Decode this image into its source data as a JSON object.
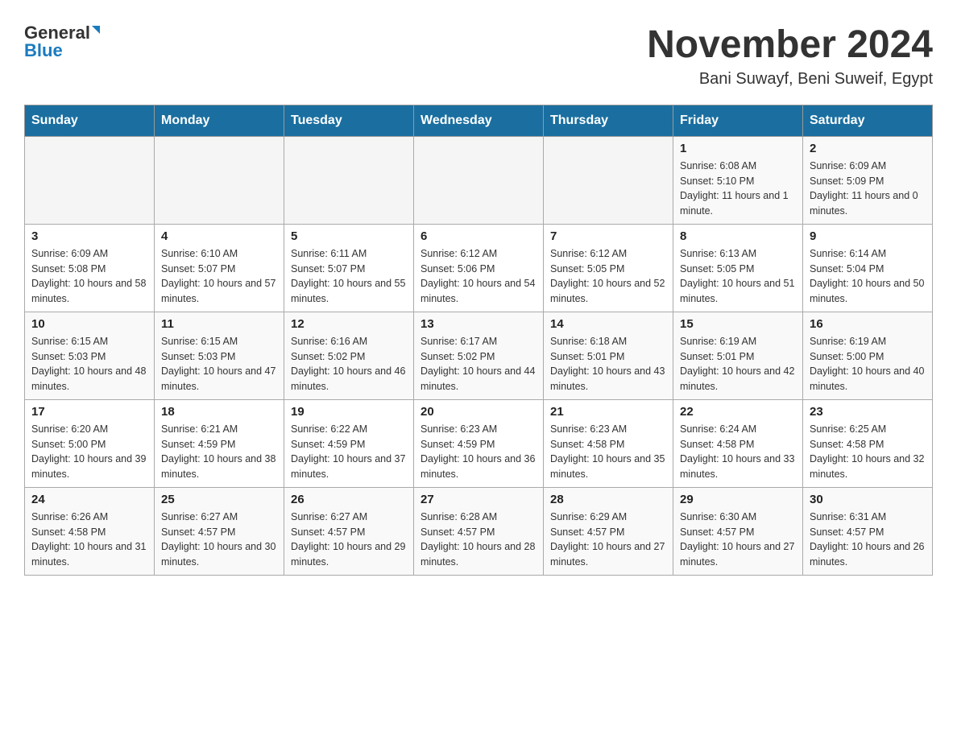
{
  "header": {
    "logo_general": "General",
    "logo_blue": "Blue",
    "title": "November 2024",
    "subtitle": "Bani Suwayf, Beni Suweif, Egypt"
  },
  "days_of_week": [
    "Sunday",
    "Monday",
    "Tuesday",
    "Wednesday",
    "Thursday",
    "Friday",
    "Saturday"
  ],
  "weeks": [
    {
      "days": [
        {
          "number": "",
          "info": ""
        },
        {
          "number": "",
          "info": ""
        },
        {
          "number": "",
          "info": ""
        },
        {
          "number": "",
          "info": ""
        },
        {
          "number": "",
          "info": ""
        },
        {
          "number": "1",
          "info": "Sunrise: 6:08 AM\nSunset: 5:10 PM\nDaylight: 11 hours and 1 minute."
        },
        {
          "number": "2",
          "info": "Sunrise: 6:09 AM\nSunset: 5:09 PM\nDaylight: 11 hours and 0 minutes."
        }
      ]
    },
    {
      "days": [
        {
          "number": "3",
          "info": "Sunrise: 6:09 AM\nSunset: 5:08 PM\nDaylight: 10 hours and 58 minutes."
        },
        {
          "number": "4",
          "info": "Sunrise: 6:10 AM\nSunset: 5:07 PM\nDaylight: 10 hours and 57 minutes."
        },
        {
          "number": "5",
          "info": "Sunrise: 6:11 AM\nSunset: 5:07 PM\nDaylight: 10 hours and 55 minutes."
        },
        {
          "number": "6",
          "info": "Sunrise: 6:12 AM\nSunset: 5:06 PM\nDaylight: 10 hours and 54 minutes."
        },
        {
          "number": "7",
          "info": "Sunrise: 6:12 AM\nSunset: 5:05 PM\nDaylight: 10 hours and 52 minutes."
        },
        {
          "number": "8",
          "info": "Sunrise: 6:13 AM\nSunset: 5:05 PM\nDaylight: 10 hours and 51 minutes."
        },
        {
          "number": "9",
          "info": "Sunrise: 6:14 AM\nSunset: 5:04 PM\nDaylight: 10 hours and 50 minutes."
        }
      ]
    },
    {
      "days": [
        {
          "number": "10",
          "info": "Sunrise: 6:15 AM\nSunset: 5:03 PM\nDaylight: 10 hours and 48 minutes."
        },
        {
          "number": "11",
          "info": "Sunrise: 6:15 AM\nSunset: 5:03 PM\nDaylight: 10 hours and 47 minutes."
        },
        {
          "number": "12",
          "info": "Sunrise: 6:16 AM\nSunset: 5:02 PM\nDaylight: 10 hours and 46 minutes."
        },
        {
          "number": "13",
          "info": "Sunrise: 6:17 AM\nSunset: 5:02 PM\nDaylight: 10 hours and 44 minutes."
        },
        {
          "number": "14",
          "info": "Sunrise: 6:18 AM\nSunset: 5:01 PM\nDaylight: 10 hours and 43 minutes."
        },
        {
          "number": "15",
          "info": "Sunrise: 6:19 AM\nSunset: 5:01 PM\nDaylight: 10 hours and 42 minutes."
        },
        {
          "number": "16",
          "info": "Sunrise: 6:19 AM\nSunset: 5:00 PM\nDaylight: 10 hours and 40 minutes."
        }
      ]
    },
    {
      "days": [
        {
          "number": "17",
          "info": "Sunrise: 6:20 AM\nSunset: 5:00 PM\nDaylight: 10 hours and 39 minutes."
        },
        {
          "number": "18",
          "info": "Sunrise: 6:21 AM\nSunset: 4:59 PM\nDaylight: 10 hours and 38 minutes."
        },
        {
          "number": "19",
          "info": "Sunrise: 6:22 AM\nSunset: 4:59 PM\nDaylight: 10 hours and 37 minutes."
        },
        {
          "number": "20",
          "info": "Sunrise: 6:23 AM\nSunset: 4:59 PM\nDaylight: 10 hours and 36 minutes."
        },
        {
          "number": "21",
          "info": "Sunrise: 6:23 AM\nSunset: 4:58 PM\nDaylight: 10 hours and 35 minutes."
        },
        {
          "number": "22",
          "info": "Sunrise: 6:24 AM\nSunset: 4:58 PM\nDaylight: 10 hours and 33 minutes."
        },
        {
          "number": "23",
          "info": "Sunrise: 6:25 AM\nSunset: 4:58 PM\nDaylight: 10 hours and 32 minutes."
        }
      ]
    },
    {
      "days": [
        {
          "number": "24",
          "info": "Sunrise: 6:26 AM\nSunset: 4:58 PM\nDaylight: 10 hours and 31 minutes."
        },
        {
          "number": "25",
          "info": "Sunrise: 6:27 AM\nSunset: 4:57 PM\nDaylight: 10 hours and 30 minutes."
        },
        {
          "number": "26",
          "info": "Sunrise: 6:27 AM\nSunset: 4:57 PM\nDaylight: 10 hours and 29 minutes."
        },
        {
          "number": "27",
          "info": "Sunrise: 6:28 AM\nSunset: 4:57 PM\nDaylight: 10 hours and 28 minutes."
        },
        {
          "number": "28",
          "info": "Sunrise: 6:29 AM\nSunset: 4:57 PM\nDaylight: 10 hours and 27 minutes."
        },
        {
          "number": "29",
          "info": "Sunrise: 6:30 AM\nSunset: 4:57 PM\nDaylight: 10 hours and 27 minutes."
        },
        {
          "number": "30",
          "info": "Sunrise: 6:31 AM\nSunset: 4:57 PM\nDaylight: 10 hours and 26 minutes."
        }
      ]
    }
  ]
}
